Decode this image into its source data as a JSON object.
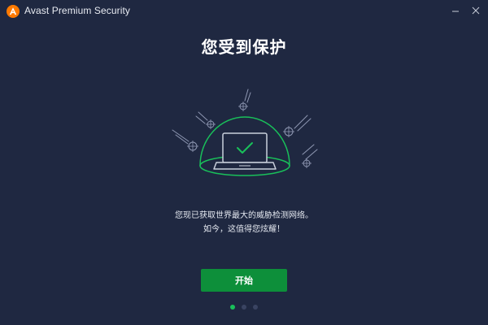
{
  "window": {
    "title": "Avast Premium Security",
    "logo_icon": "avast-logo-icon",
    "minimize_icon": "minimize-icon",
    "close_icon": "close-icon"
  },
  "onboarding": {
    "headline": "您受到保护",
    "description_line1": "您现已获取世界最大的威胁检测网络。",
    "description_line2": "如今，这值得您炫耀！",
    "illustration_icons": [
      "protection-dome-icon",
      "laptop-icon",
      "checkmark-icon",
      "threat-icon"
    ],
    "start_label": "开始"
  },
  "pager": {
    "total_pages": 3,
    "current_page": 1
  },
  "colors": {
    "background": "#1f2841",
    "accent_green": "#19c05a",
    "button_green": "#0d8f3a",
    "brand_orange": "#ff7a00",
    "inactive_dot": "#3a4462"
  }
}
